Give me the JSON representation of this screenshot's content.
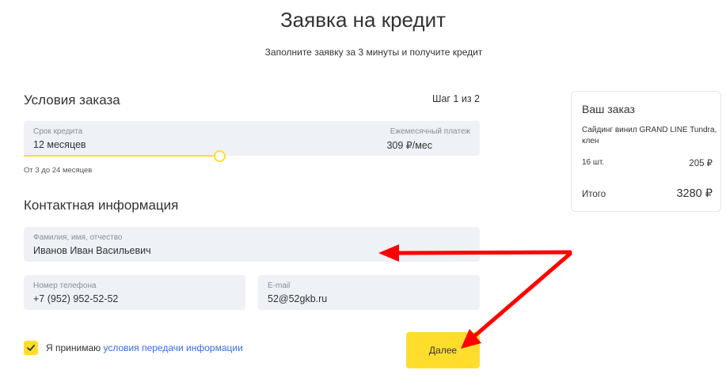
{
  "header": {
    "title": "Заявка на кредит",
    "subtitle": "Заполните заявку за 3 минуты и получите кредит"
  },
  "order_conditions": {
    "title": "Условия заказа",
    "step": "Шаг 1 из 2",
    "term_label": "Срок кредита",
    "term_value": "12 месяцев",
    "payment_label": "Ежемесячный платеж",
    "payment_value": "309 ₽/мес",
    "term_fraction": 0.43,
    "hint": "От 3 до 24 месяцев"
  },
  "contact": {
    "title": "Контактная информация",
    "name_label": "Фамилия, имя, отчество",
    "name_value": "Иванов Иван Васильевич",
    "phone_label": "Номер телефона",
    "phone_value": "+7 (952) 952-52-52",
    "email_label": "E-mail",
    "email_value": "52@52gkb.ru"
  },
  "consent": {
    "checked": true,
    "text": "Я принимаю",
    "link": "условия передачи информации"
  },
  "next_button": "Далее",
  "order": {
    "title": "Ваш заказ",
    "product": "Сайдинг винил GRAND LINE Tundra, клен",
    "qty": "16 шт.",
    "price": "205 ₽",
    "total_label": "Итого",
    "total_value": "3280 ₽"
  },
  "colors": {
    "accent": "#ffdd2d",
    "field_bg": "#eef1f6",
    "link": "#336fee",
    "annotation_arrow": "#ff0000"
  }
}
